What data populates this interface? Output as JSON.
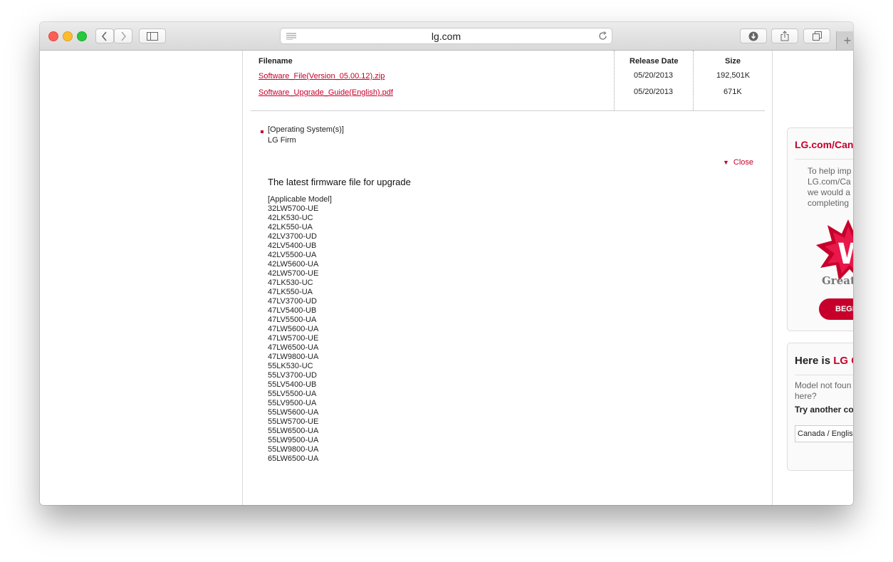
{
  "browser": {
    "url": "lg.com",
    "icons": {
      "back": "chevron-left-icon",
      "forward": "chevron-right-icon",
      "sidebar": "sidebar-icon",
      "reader": "reader-icon",
      "reload": "reload-icon",
      "download": "download-icon",
      "share": "share-icon",
      "tabs": "tabs-icon",
      "new_tab": "plus-icon"
    },
    "new_tab_label": "+"
  },
  "file_table": {
    "headers": {
      "filename": "Filename",
      "release_date": "Release Date",
      "size": "Size"
    },
    "rows": [
      {
        "filename": "Software_File(Version_05.00.12).zip",
        "release_date": "05/20/2013",
        "size": "192,501K"
      },
      {
        "filename": "Software_Upgrade_Guide(English).pdf",
        "release_date": "05/20/2013",
        "size": "671K"
      }
    ]
  },
  "details": {
    "os_label": "[Operating System(s)]",
    "os_value": "LG Firm",
    "close_label": "Close",
    "firmware_title": "The latest firmware file for upgrade",
    "applicable_label": "[Applicable Model]",
    "models": [
      "32LW5700-UE",
      "42LK530-UC",
      "42LK550-UA",
      "42LV3700-UD",
      "42LV5400-UB",
      "42LV5500-UA",
      "42LW5600-UA",
      "42LW5700-UE",
      "47LK530-UC",
      "47LK550-UA",
      "47LV3700-UD",
      "47LV5400-UB",
      "47LV5500-UA",
      "47LW5600-UA",
      "47LW5700-UE",
      "47LW6500-UA",
      "47LW9800-UA",
      "55LK530-UC",
      "55LV3700-UD",
      "55LV5400-UB",
      "55LV5500-UA",
      "55LV9500-UA",
      "55LW5600-UA",
      "55LW5700-UE",
      "55LW6500-UA",
      "55LW9500-UA",
      "55LW9800-UA",
      "65LW6500-UA"
    ]
  },
  "survey": {
    "title": "LG.com/Cana",
    "lines": [
      "To help imp",
      "LG.com/Ca",
      "we would a",
      "completing"
    ],
    "badge_letter": "W",
    "great": "Great",
    "button": "BEGI",
    "accent": "#c6002b"
  },
  "locale": {
    "title_prefix": "Here is ",
    "title_red": "LG C",
    "text_line1": "Model not foun",
    "text_line2": "here?",
    "try_text": "Try another co",
    "selected_country": "Canada / Englis"
  }
}
